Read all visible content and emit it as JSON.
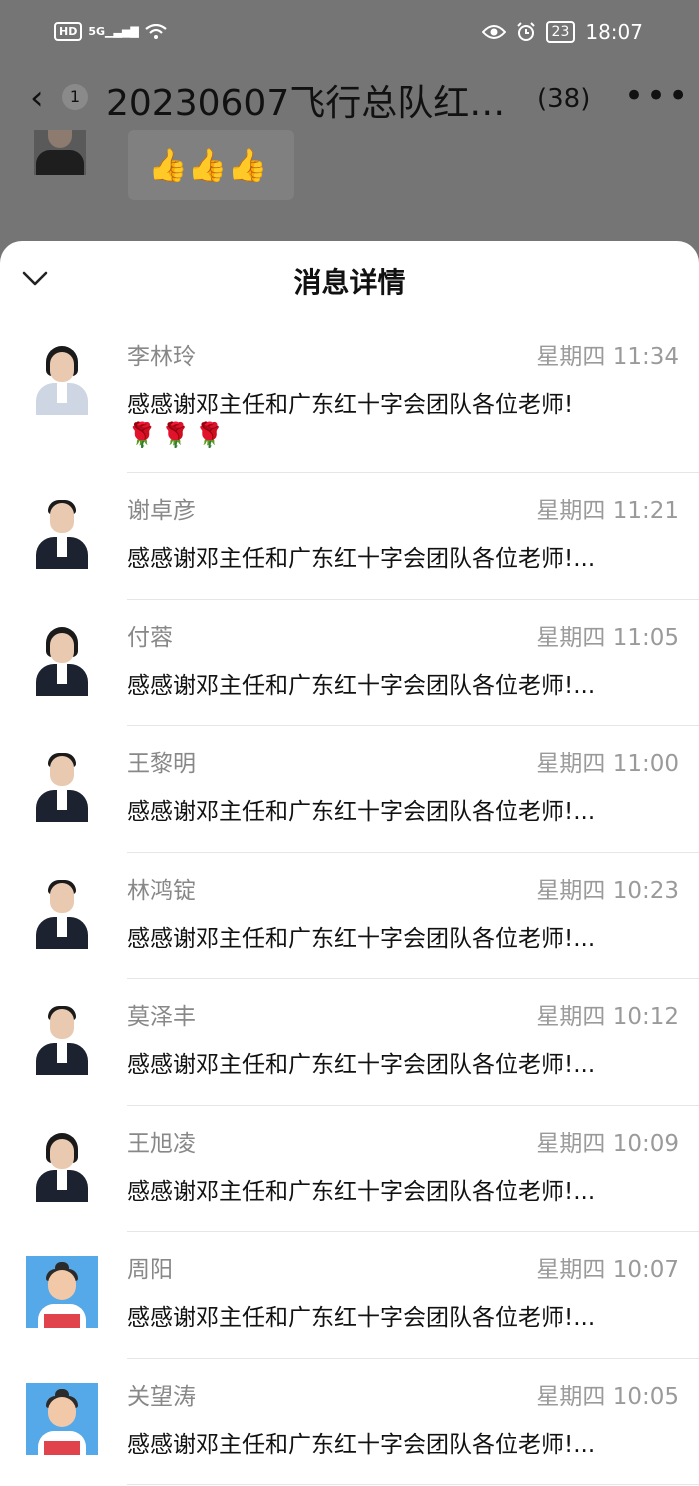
{
  "status_bar": {
    "hd_label": "HD",
    "network_label": "5G",
    "battery_label": "23",
    "time": "18:07",
    "icons": [
      "hd-icon",
      "signal-icon",
      "wifi-icon",
      "eye-icon",
      "alarm-icon",
      "battery-icon"
    ]
  },
  "chat_header": {
    "unread_count": "1",
    "title": "20230607飞行总队红…",
    "member_count": "(38)",
    "more_label": "•••"
  },
  "background_chat": {
    "bubble_emoji": "👍👍👍"
  },
  "sheet": {
    "title": "消息详情",
    "items": [
      {
        "name": "李林玲",
        "time": "星期四 11:34",
        "message": "感感谢邓主任和广东红十字会团队各位老师!",
        "message_extra": "🌹🌹🌹",
        "avatar": "photo-female-light"
      },
      {
        "name": "谢卓彦",
        "time": "星期四 11:21",
        "message": "感感谢邓主任和广东红十字会团队各位老师!...",
        "avatar": "photo-male"
      },
      {
        "name": "付蓉",
        "time": "星期四 11:05",
        "message": "感感谢邓主任和广东红十字会团队各位老师!...",
        "avatar": "photo-female"
      },
      {
        "name": "王黎明",
        "time": "星期四 11:00",
        "message": "感感谢邓主任和广东红十字会团队各位老师!...",
        "avatar": "photo-male"
      },
      {
        "name": "林鸿锭",
        "time": "星期四 10:23",
        "message": "感感谢邓主任和广东红十字会团队各位老师!...",
        "avatar": "photo-male"
      },
      {
        "name": "莫泽丰",
        "time": "星期四 10:12",
        "message": "感感谢邓主任和广东红十字会团队各位老师!...",
        "avatar": "photo-male"
      },
      {
        "name": "王旭凌",
        "time": "星期四 10:09",
        "message": "感感谢邓主任和广东红十字会团队各位老师!...",
        "avatar": "photo-female"
      },
      {
        "name": "周阳",
        "time": "星期四 10:07",
        "message": "感感谢邓主任和广东红十字会团队各位老师!...",
        "avatar": "cartoon"
      },
      {
        "name": "关望涛",
        "time": "星期四 10:05",
        "message": "感感谢邓主任和广东红十字会团队各位老师!...",
        "avatar": "cartoon"
      }
    ]
  },
  "colors": {
    "overlay": "#6b6b6b",
    "sheet_bg": "#ffffff",
    "name_text": "#888888",
    "message_text": "#111111",
    "cartoon_bg": "#56a9e8"
  }
}
